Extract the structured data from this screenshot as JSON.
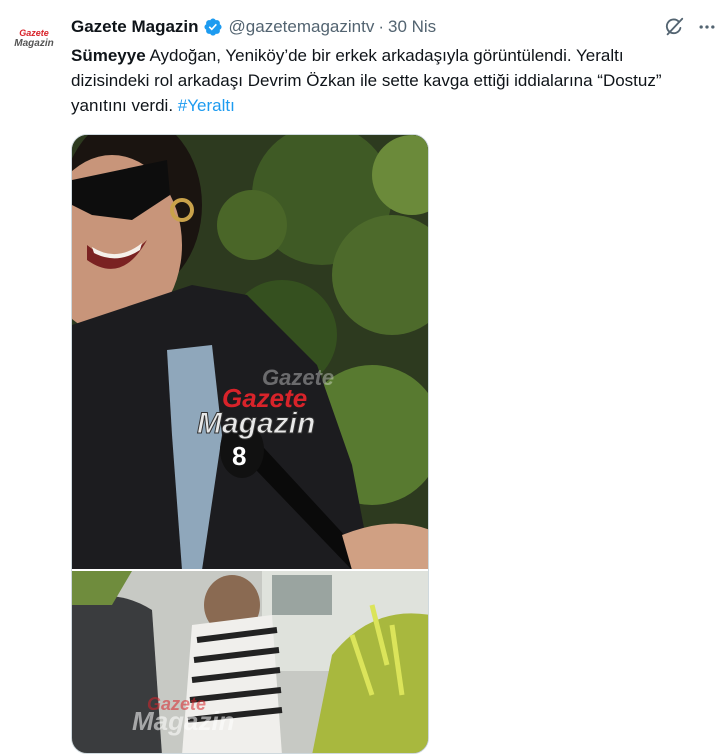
{
  "account": {
    "display_name": "Gazete Magazin",
    "handle": "@gazetemagazintv",
    "separator": "·",
    "date": "30 Nis",
    "avatar_logo_text": [
      "Gazete",
      "Magazin"
    ]
  },
  "tweet": {
    "bold_lead": "Sümeyye",
    "body": " Aydoğan, Yeniköy’de bir erkek arkadaşıyla görüntülendi. Yeraltı dizisindeki rol arkadaşı Devrim Özkan ile sette kavga ettiği iddialarına “Dostuz” yanıtını verdi. ",
    "hashtag": "#Yeraltı"
  },
  "media": {
    "watermark_top": "Gazete",
    "watermark_bottom": "Magazin"
  },
  "icons": {
    "verified": "verified-badge-icon",
    "grok": "grok-icon",
    "more": "more-options-icon"
  },
  "colors": {
    "verified": "#1d9bf0",
    "hashtag": "#1d9bf0",
    "secondary_text": "#536471",
    "logo_red": "#d8232a"
  }
}
